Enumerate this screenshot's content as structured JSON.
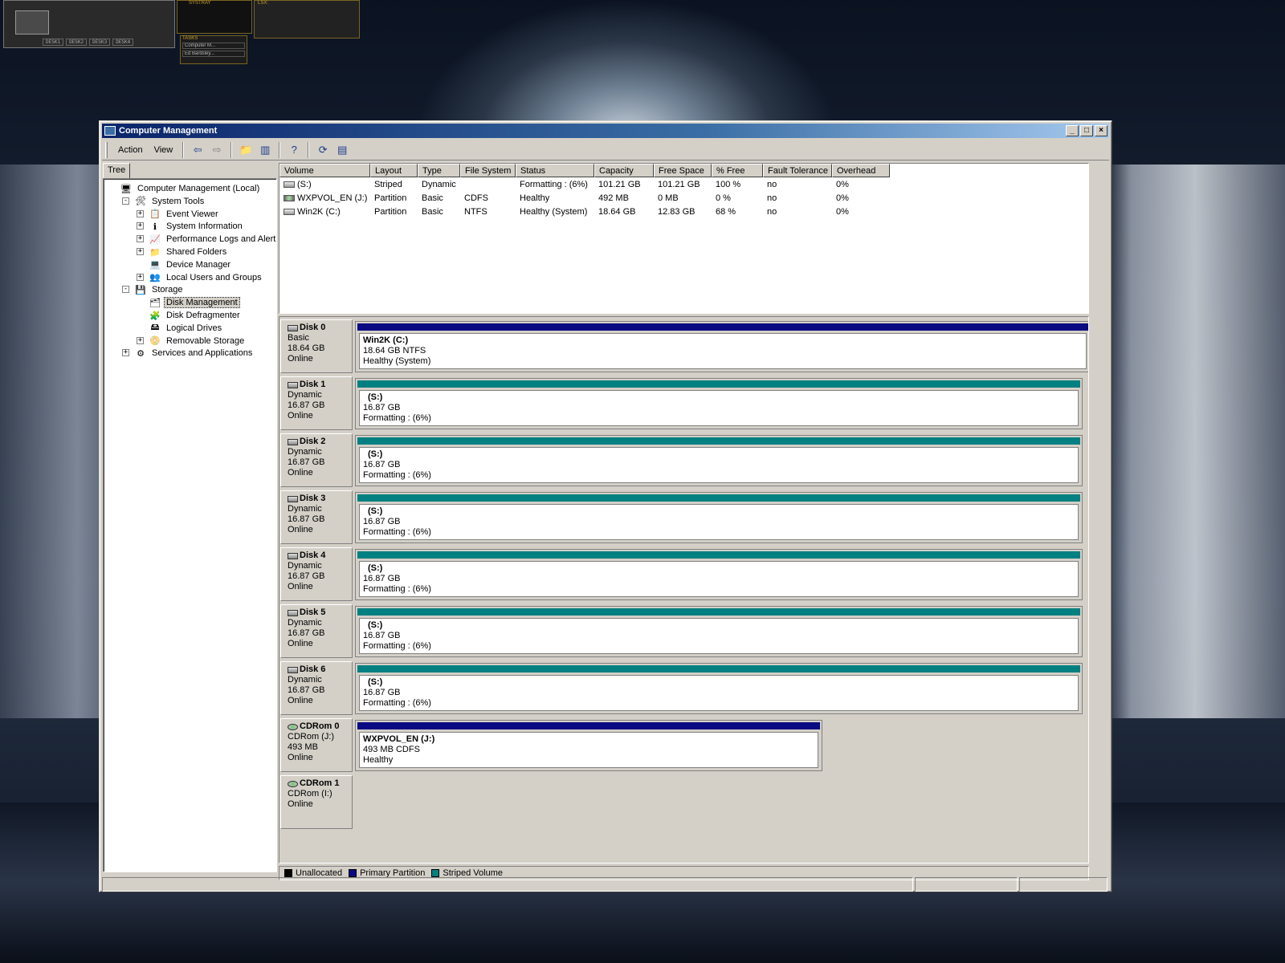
{
  "deskbar": {
    "desks": [
      "DESK1",
      "DESK2",
      "DESK3",
      "DESK4"
    ],
    "systray_label": "SYSTRAY",
    "tasks_label": "TASKS",
    "tasks": [
      "Computer M...",
      "Ed Bardsley..."
    ],
    "lsx_label": "LSX:"
  },
  "window": {
    "title": "Computer Management",
    "menu": {
      "action": "Action",
      "view": "View"
    },
    "tree_tab": "Tree"
  },
  "tree": [
    {
      "label": "Computer Management (Local)",
      "level": 0,
      "expander": "",
      "icon": "computer-icon",
      "glyph": "🖥"
    },
    {
      "label": "System Tools",
      "level": 1,
      "expander": "−",
      "icon": "system-tools-icon",
      "glyph": "🛠"
    },
    {
      "label": "Event Viewer",
      "level": 2,
      "expander": "+",
      "icon": "event-viewer-icon",
      "glyph": "📋"
    },
    {
      "label": "System Information",
      "level": 2,
      "expander": "+",
      "icon": "system-information-icon",
      "glyph": "ℹ"
    },
    {
      "label": "Performance Logs and Alerts",
      "level": 2,
      "expander": "+",
      "icon": "performance-logs-icon",
      "glyph": "📈"
    },
    {
      "label": "Shared Folders",
      "level": 2,
      "expander": "+",
      "icon": "shared-folders-icon",
      "glyph": "📁"
    },
    {
      "label": "Device Manager",
      "level": 2,
      "expander": "",
      "icon": "device-manager-icon",
      "glyph": "💻"
    },
    {
      "label": "Local Users and Groups",
      "level": 2,
      "expander": "+",
      "icon": "local-users-icon",
      "glyph": "👥"
    },
    {
      "label": "Storage",
      "level": 1,
      "expander": "−",
      "icon": "storage-icon",
      "glyph": "💾"
    },
    {
      "label": "Disk Management",
      "level": 2,
      "expander": "",
      "icon": "disk-management-icon",
      "glyph": "🗂",
      "selected": true
    },
    {
      "label": "Disk Defragmenter",
      "level": 2,
      "expander": "",
      "icon": "disk-defragmenter-icon",
      "glyph": "🧩"
    },
    {
      "label": "Logical Drives",
      "level": 2,
      "expander": "",
      "icon": "logical-drives-icon",
      "glyph": "🖴"
    },
    {
      "label": "Removable Storage",
      "level": 2,
      "expander": "+",
      "icon": "removable-storage-icon",
      "glyph": "📀"
    },
    {
      "label": "Services and Applications",
      "level": 1,
      "expander": "+",
      "icon": "services-icon",
      "glyph": "⚙"
    }
  ],
  "volume_list": {
    "columns": [
      "Volume",
      "Layout",
      "Type",
      "File System",
      "Status",
      "Capacity",
      "Free Space",
      "% Free",
      "Fault Tolerance",
      "Overhead"
    ],
    "rows": [
      {
        "icon": "hard-drive-icon",
        "cells": [
          "(S:)",
          "Striped",
          "Dynamic",
          "",
          "Formatting : (6%)",
          "101.21 GB",
          "101.21 GB",
          "100 %",
          "no",
          "0%"
        ]
      },
      {
        "icon": "cdrom-icon",
        "cells": [
          "WXPVOL_EN (J:)",
          "Partition",
          "Basic",
          "CDFS",
          "Healthy",
          "492 MB",
          "0 MB",
          "0 %",
          "no",
          "0%"
        ]
      },
      {
        "icon": "hard-drive-icon",
        "cells": [
          "Win2K (C:)",
          "Partition",
          "Basic",
          "NTFS",
          "Healthy (System)",
          "18.64 GB",
          "12.83 GB",
          "68 %",
          "no",
          "0%"
        ]
      }
    ]
  },
  "colors": {
    "primary_partition": "#0a0a82",
    "striped_volume": "#008080",
    "unallocated": "#000000"
  },
  "disks": [
    {
      "name": "Disk 0",
      "type": "Basic",
      "size": "18.64 GB",
      "state": "Online",
      "icon": "hard-drive-icon",
      "volume": {
        "name": "Win2K  (C:)",
        "size": "18.64 GB NTFS",
        "status": "Healthy (System)",
        "kind": "primary",
        "bold": true
      }
    },
    {
      "name": "Disk 1",
      "type": "Dynamic",
      "size": "16.87 GB",
      "state": "Online",
      "icon": "hard-drive-icon",
      "volume": {
        "name": "(S:)",
        "size": "16.87 GB",
        "status": "Formatting : (6%)",
        "kind": "striped",
        "bold": false
      }
    },
    {
      "name": "Disk 2",
      "type": "Dynamic",
      "size": "16.87 GB",
      "state": "Online",
      "icon": "hard-drive-icon",
      "volume": {
        "name": "(S:)",
        "size": "16.87 GB",
        "status": "Formatting : (6%)",
        "kind": "striped",
        "bold": false
      }
    },
    {
      "name": "Disk 3",
      "type": "Dynamic",
      "size": "16.87 GB",
      "state": "Online",
      "icon": "hard-drive-icon",
      "volume": {
        "name": "(S:)",
        "size": "16.87 GB",
        "status": "Formatting : (6%)",
        "kind": "striped",
        "bold": false
      }
    },
    {
      "name": "Disk 4",
      "type": "Dynamic",
      "size": "16.87 GB",
      "state": "Online",
      "icon": "hard-drive-icon",
      "volume": {
        "name": "(S:)",
        "size": "16.87 GB",
        "status": "Formatting : (6%)",
        "kind": "striped",
        "bold": false
      }
    },
    {
      "name": "Disk 5",
      "type": "Dynamic",
      "size": "16.87 GB",
      "state": "Online",
      "icon": "hard-drive-icon",
      "volume": {
        "name": "(S:)",
        "size": "16.87 GB",
        "status": "Formatting : (6%)",
        "kind": "striped",
        "bold": false
      }
    },
    {
      "name": "Disk 6",
      "type": "Dynamic",
      "size": "16.87 GB",
      "state": "Online",
      "icon": "hard-drive-icon",
      "volume": {
        "name": "(S:)",
        "size": "16.87 GB",
        "status": "Formatting : (6%)",
        "kind": "striped",
        "bold": false
      }
    },
    {
      "name": "CDRom 0",
      "type": "CDRom (J:)",
      "size": "493 MB",
      "state": "Online",
      "icon": "cdrom-icon",
      "volume": {
        "name": "WXPVOL_EN  (J:)",
        "size": "493 MB CDFS",
        "status": "Healthy",
        "kind": "primary",
        "bold": true
      }
    },
    {
      "name": "CDRom 1",
      "type": "CDRom (I:)",
      "size": "",
      "state": "Online",
      "icon": "cdrom-icon",
      "volume": null
    }
  ],
  "legend": [
    {
      "label": "Unallocated",
      "color": "#000000"
    },
    {
      "label": "Primary Partition",
      "color": "#0a0a82"
    },
    {
      "label": "Striped Volume",
      "color": "#008080"
    }
  ]
}
